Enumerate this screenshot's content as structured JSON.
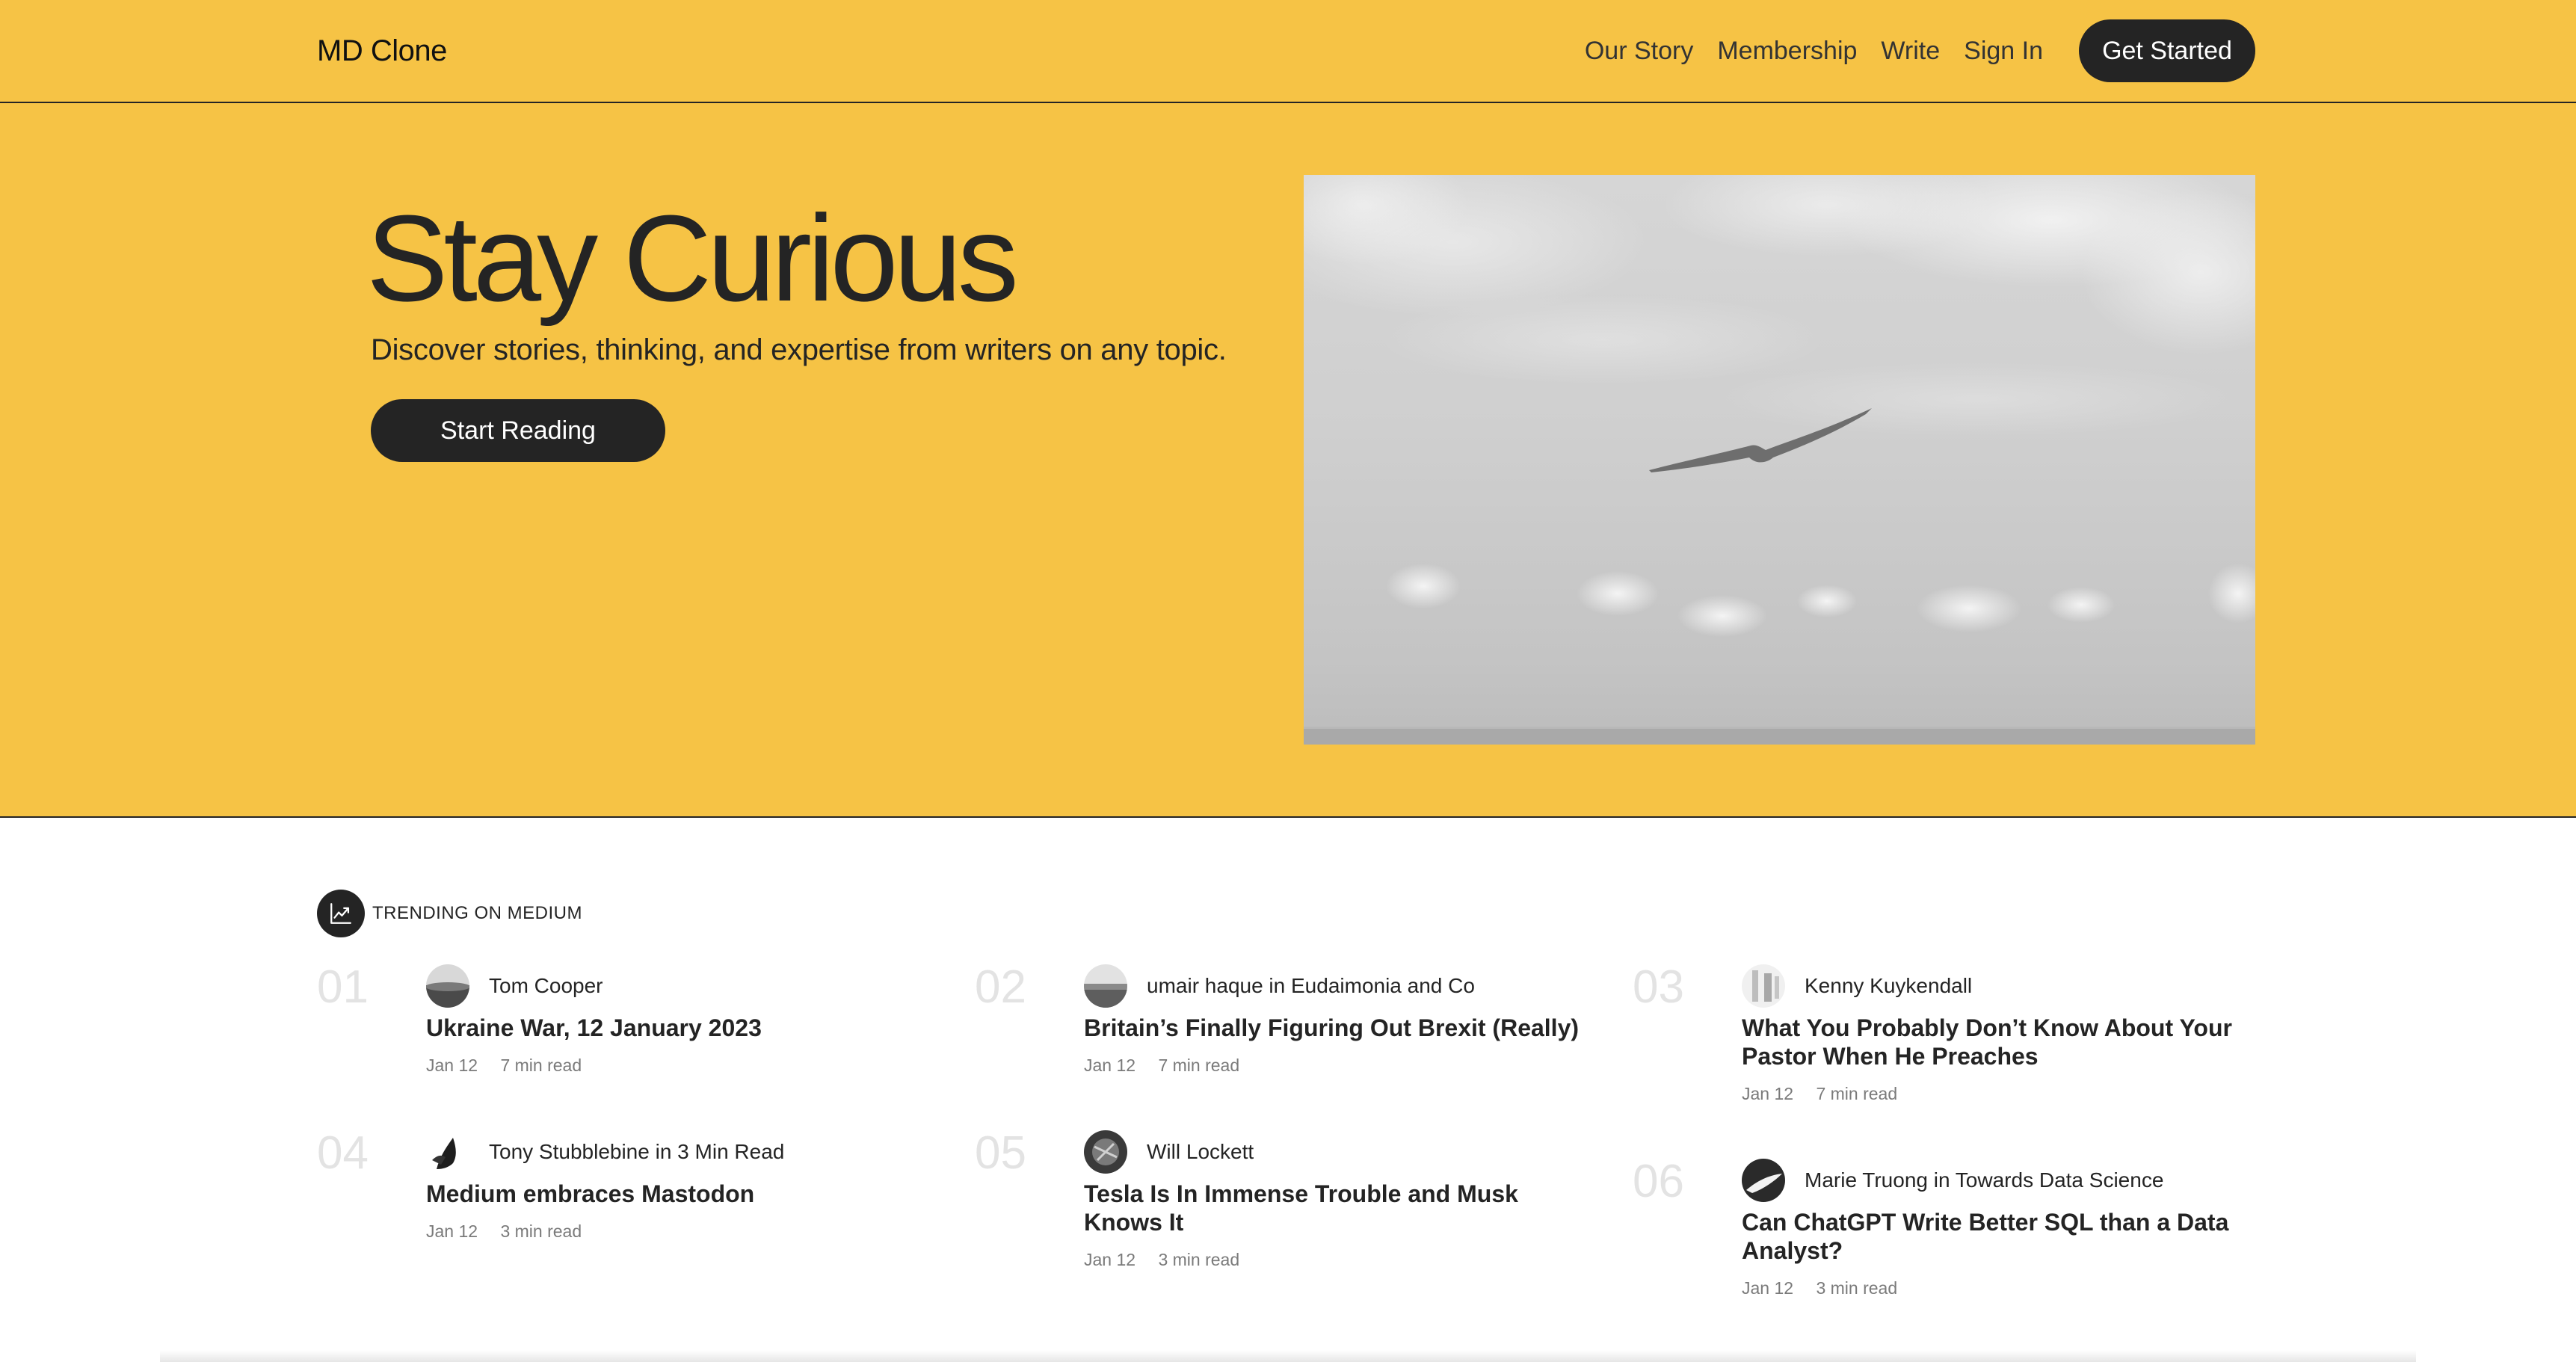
{
  "nav": {
    "brand": "MD Clone",
    "links": [
      "Our Story",
      "Membership",
      "Write",
      "Sign In"
    ],
    "cta": "Get Started"
  },
  "hero": {
    "title": "Stay Curious",
    "subtitle": "Discover stories, thinking, and expertise from writers on any topic.",
    "cta": "Start Reading",
    "image_icon": "seagull-over-sea-photo"
  },
  "trending": {
    "icon": "trending-up-icon",
    "label": "TRENDING ON MEDIUM",
    "items": [
      {
        "num": "01",
        "author": "Tom Cooper",
        "title": "Ukraine War, 12 January 2023",
        "date": "Jan 12",
        "read": "7 min read"
      },
      {
        "num": "02",
        "author": "umair haque in Eudaimonia and Co",
        "title": "Britain’s Finally Figuring Out Brexit (Really)",
        "date": "Jan 12",
        "read": "7 min read"
      },
      {
        "num": "03",
        "author": "Kenny Kuykendall",
        "title": "What You Probably Don’t Know About Your Pastor When He Preaches",
        "date": "Jan 12",
        "read": "7 min read"
      },
      {
        "num": "04",
        "author": "Tony Stubblebine in 3 Min Read",
        "title": "Medium embraces Mastodon",
        "date": "Jan 12",
        "read": "3 min read"
      },
      {
        "num": "05",
        "author": "Will Lockett",
        "title": "Tesla Is In Immense Trouble and Musk Knows It",
        "date": "Jan 12",
        "read": "3 min read"
      },
      {
        "num": "06",
        "author": "Marie Truong in Towards Data Science",
        "title": "Can ChatGPT Write Better SQL than a Data Analyst?",
        "date": "Jan 12",
        "read": "3 min read"
      }
    ]
  },
  "colors": {
    "accent": "#f6c345",
    "dark": "#242424",
    "number_gray": "#e3e3e3",
    "meta_gray": "#7a7a7a"
  }
}
